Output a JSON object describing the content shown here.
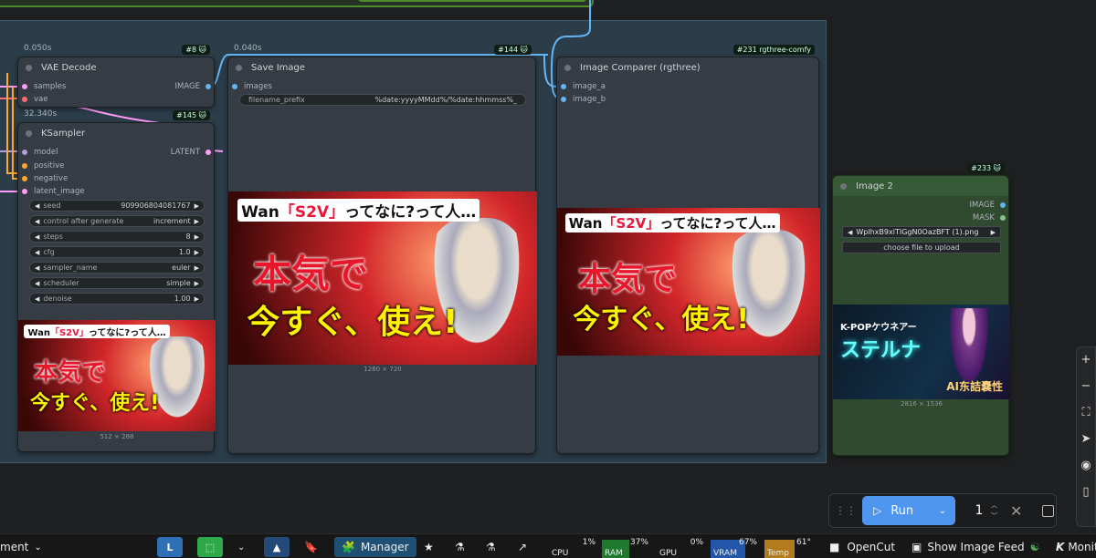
{
  "nodes": {
    "vae_decode": {
      "title": "VAE Decode",
      "time": "0.050s",
      "badge": "#8 🐱",
      "inputs": [
        "samples",
        "vae"
      ],
      "output": "IMAGE"
    },
    "ksampler": {
      "title": "KSampler",
      "time": "32.340s",
      "badge": "#145 🐱",
      "inputs": [
        "model",
        "positive",
        "negative",
        "latent_image"
      ],
      "output": "LATENT",
      "widgets": [
        {
          "label": "seed",
          "value": "909906804081767"
        },
        {
          "label": "control after generate",
          "value": "increment"
        },
        {
          "label": "steps",
          "value": "8"
        },
        {
          "label": "cfg",
          "value": "1.0"
        },
        {
          "label": "sampler_name",
          "value": "euler"
        },
        {
          "label": "scheduler",
          "value": "simple"
        },
        {
          "label": "denoise",
          "value": "1.00"
        }
      ],
      "image_size": "512 × 288"
    },
    "save_image": {
      "title": "Save Image",
      "time": "0.040s",
      "badge": "#144 🐱",
      "input": "images",
      "prefix_label": "filename_prefix",
      "prefix_value": "%date:yyyyMMdd%/%date:hhmmss%_",
      "image_size": "1280 × 720"
    },
    "comparer": {
      "title": "Image Comparer (rgthree)",
      "badge": "#231 rgthree-comfy",
      "inputs": [
        "image_a",
        "image_b"
      ]
    },
    "image2": {
      "title": "Image 2",
      "badge": "#233 🐱",
      "outputs": [
        "IMAGE",
        "MASK"
      ],
      "file": "WplhxB9xlTIGgN0OazBFT (1).png",
      "upload_label": "choose file to upload",
      "image_size": "2816 × 1536",
      "thumb_line1": "K-POPケウネアー",
      "thumb_big": "ステルナ",
      "thumb_sub": "AI东詰嚢性"
    }
  },
  "thumb": {
    "title_pre": "Wan",
    "title_hl": "「S2V」",
    "title_post": "ってなに?って人…",
    "big1": "本気で",
    "big2": "今すぐ、使え!"
  },
  "side_toolbar": [
    "+",
    "−",
    "⛶",
    "➤",
    "◉",
    "▯"
  ],
  "run_panel": {
    "run_label": "Run",
    "count": "1"
  },
  "taskbar": {
    "left_text": "ment",
    "manager_label": "Manager",
    "stats": [
      {
        "label": "CPU",
        "value": "1%",
        "color": "#1e1e1e"
      },
      {
        "label": "RAM",
        "value": "37%",
        "color": "#1f7a2d"
      },
      {
        "label": "GPU",
        "value": "0%",
        "color": "#1e1e1e"
      },
      {
        "label": "VRAM",
        "value": "67%",
        "color": "#2356a8"
      },
      {
        "label": "Temp",
        "value": "61°",
        "color": "#b27b1c"
      }
    ],
    "opencut": "OpenCut",
    "show_feed": "Show Image Feed",
    "monitor": "Monito"
  }
}
